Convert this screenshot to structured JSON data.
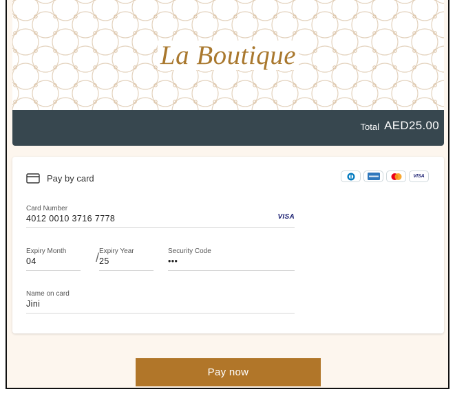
{
  "brand": {
    "name": "La Boutique"
  },
  "summary": {
    "total_label": "Total",
    "total_amount": "AED25.00"
  },
  "payment": {
    "method_label": "Pay by card",
    "accepted_cards": [
      "diners-club-icon",
      "amex-icon",
      "mastercard-icon",
      "visa-icon"
    ],
    "visa_mini": "VISA"
  },
  "form": {
    "card_number": {
      "label": "Card Number",
      "value": "4012 0010 3716 7778",
      "brand": "VISA"
    },
    "expiry_month": {
      "label": "Expiry Month",
      "value": "04"
    },
    "expiry_separator": "/",
    "expiry_year": {
      "label": "Expiry Year",
      "value": "25"
    },
    "security_code": {
      "label": "Security Code",
      "value": "•••"
    },
    "name_on_card": {
      "label": "Name on card",
      "value": "Jini"
    }
  },
  "actions": {
    "pay_label": "Pay now"
  },
  "colors": {
    "accent_gold": "#b17629",
    "brand_text": "#a9782e",
    "total_bar": "#37474f",
    "page_background": "#fdf6ee"
  }
}
